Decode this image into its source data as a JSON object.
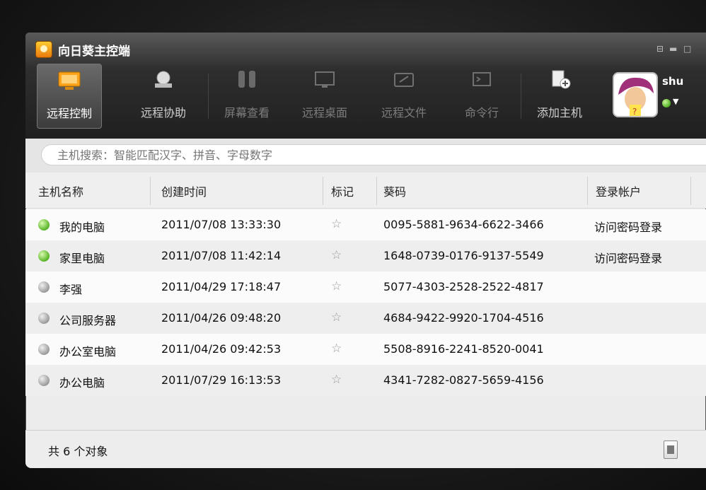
{
  "app": {
    "title": "向日葵主控端"
  },
  "window_controls": [
    "minimize",
    "maximize"
  ],
  "toolbar": [
    {
      "label": "远程控制",
      "state": "active",
      "icon": "remote-control-icon"
    },
    {
      "label": "远程协助",
      "state": "enabled",
      "icon": "remote-assist-icon"
    },
    {
      "label": "屏幕查看",
      "state": "disabled",
      "icon": "screen-view-icon"
    },
    {
      "label": "远程桌面",
      "state": "disabled",
      "icon": "remote-desktop-icon"
    },
    {
      "label": "远程文件",
      "state": "disabled",
      "icon": "remote-file-icon"
    },
    {
      "label": "命令行",
      "state": "disabled",
      "icon": "command-line-icon"
    },
    {
      "label": "添加主机",
      "state": "enabled",
      "icon": "add-host-icon"
    }
  ],
  "user": {
    "name": "shu",
    "status_color": "#52b124"
  },
  "search": {
    "placeholder": "主机搜索：智能匹配汉字、拼音、字母数字"
  },
  "table": {
    "headers": [
      "主机名称",
      "创建时间",
      "标记",
      "葵码",
      "登录帐户"
    ],
    "rows": [
      {
        "status": "online",
        "name": "我的电脑",
        "created": "2011/07/08 13:33:30",
        "code": "0095-5881-9634-6622-3466",
        "login": "访问密码登录"
      },
      {
        "status": "online",
        "name": "家里电脑",
        "created": "2011/07/08 11:42:14",
        "code": "1648-0739-0176-9137-5549",
        "login": "访问密码登录"
      },
      {
        "status": "offline",
        "name": "李强",
        "created": "2011/04/29 17:18:47",
        "code": "5077-4303-2528-2522-4817",
        "login": ""
      },
      {
        "status": "offline",
        "name": "公司服务器",
        "created": "2011/04/26 09:48:20",
        "code": "4684-9422-9920-1704-4516",
        "login": ""
      },
      {
        "status": "offline",
        "name": "办公室电脑",
        "created": "2011/04/26 09:42:53",
        "code": "5508-8916-2241-8520-0041",
        "login": ""
      },
      {
        "status": "offline",
        "name": "办公电脑",
        "created": "2011/07/29 16:13:53",
        "code": "4341-7282-0827-5659-4156",
        "login": ""
      }
    ]
  },
  "footer": {
    "count_text": "共 6 个对象"
  },
  "colors": {
    "online": "#58b326",
    "offline": "#9a9a9a",
    "toolbar_bg": "#2e2e2e"
  }
}
